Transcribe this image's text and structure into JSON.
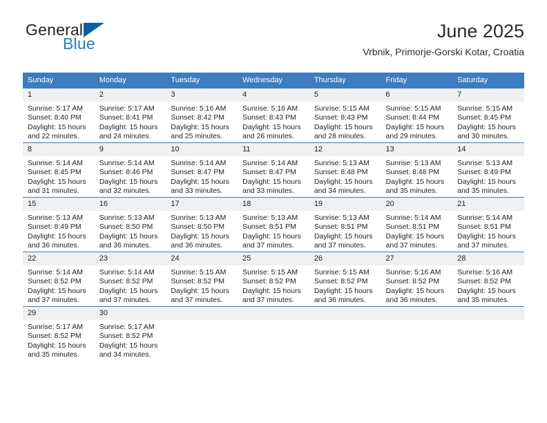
{
  "brand": {
    "word_one": "General",
    "word_two": "Blue",
    "triangle_color": "#0b5ea8",
    "blue_color": "#1f7fc4"
  },
  "header": {
    "title": "June 2025",
    "subtitle": "Vrbnik, Primorje-Gorski Kotar, Croatia"
  },
  "theme": {
    "header_blue": "#3b7dc0",
    "daynum_band": "#f0f0f0",
    "text": "#222222"
  },
  "weekdays": [
    "Sunday",
    "Monday",
    "Tuesday",
    "Wednesday",
    "Thursday",
    "Friday",
    "Saturday"
  ],
  "weeks": [
    [
      {
        "day": "1",
        "sunrise": "Sunrise: 5:17 AM",
        "sunset": "Sunset: 8:40 PM",
        "daylight": "Daylight: 15 hours and 22 minutes."
      },
      {
        "day": "2",
        "sunrise": "Sunrise: 5:17 AM",
        "sunset": "Sunset: 8:41 PM",
        "daylight": "Daylight: 15 hours and 24 minutes."
      },
      {
        "day": "3",
        "sunrise": "Sunrise: 5:16 AM",
        "sunset": "Sunset: 8:42 PM",
        "daylight": "Daylight: 15 hours and 25 minutes."
      },
      {
        "day": "4",
        "sunrise": "Sunrise: 5:16 AM",
        "sunset": "Sunset: 8:43 PM",
        "daylight": "Daylight: 15 hours and 26 minutes."
      },
      {
        "day": "5",
        "sunrise": "Sunrise: 5:15 AM",
        "sunset": "Sunset: 8:43 PM",
        "daylight": "Daylight: 15 hours and 28 minutes."
      },
      {
        "day": "6",
        "sunrise": "Sunrise: 5:15 AM",
        "sunset": "Sunset: 8:44 PM",
        "daylight": "Daylight: 15 hours and 29 minutes."
      },
      {
        "day": "7",
        "sunrise": "Sunrise: 5:15 AM",
        "sunset": "Sunset: 8:45 PM",
        "daylight": "Daylight: 15 hours and 30 minutes."
      }
    ],
    [
      {
        "day": "8",
        "sunrise": "Sunrise: 5:14 AM",
        "sunset": "Sunset: 8:45 PM",
        "daylight": "Daylight: 15 hours and 31 minutes."
      },
      {
        "day": "9",
        "sunrise": "Sunrise: 5:14 AM",
        "sunset": "Sunset: 8:46 PM",
        "daylight": "Daylight: 15 hours and 32 minutes."
      },
      {
        "day": "10",
        "sunrise": "Sunrise: 5:14 AM",
        "sunset": "Sunset: 8:47 PM",
        "daylight": "Daylight: 15 hours and 33 minutes."
      },
      {
        "day": "11",
        "sunrise": "Sunrise: 5:14 AM",
        "sunset": "Sunset: 8:47 PM",
        "daylight": "Daylight: 15 hours and 33 minutes."
      },
      {
        "day": "12",
        "sunrise": "Sunrise: 5:13 AM",
        "sunset": "Sunset: 8:48 PM",
        "daylight": "Daylight: 15 hours and 34 minutes."
      },
      {
        "day": "13",
        "sunrise": "Sunrise: 5:13 AM",
        "sunset": "Sunset: 8:48 PM",
        "daylight": "Daylight: 15 hours and 35 minutes."
      },
      {
        "day": "14",
        "sunrise": "Sunrise: 5:13 AM",
        "sunset": "Sunset: 8:49 PM",
        "daylight": "Daylight: 15 hours and 35 minutes."
      }
    ],
    [
      {
        "day": "15",
        "sunrise": "Sunrise: 5:13 AM",
        "sunset": "Sunset: 8:49 PM",
        "daylight": "Daylight: 15 hours and 36 minutes."
      },
      {
        "day": "16",
        "sunrise": "Sunrise: 5:13 AM",
        "sunset": "Sunset: 8:50 PM",
        "daylight": "Daylight: 15 hours and 36 minutes."
      },
      {
        "day": "17",
        "sunrise": "Sunrise: 5:13 AM",
        "sunset": "Sunset: 8:50 PM",
        "daylight": "Daylight: 15 hours and 36 minutes."
      },
      {
        "day": "18",
        "sunrise": "Sunrise: 5:13 AM",
        "sunset": "Sunset: 8:51 PM",
        "daylight": "Daylight: 15 hours and 37 minutes."
      },
      {
        "day": "19",
        "sunrise": "Sunrise: 5:13 AM",
        "sunset": "Sunset: 8:51 PM",
        "daylight": "Daylight: 15 hours and 37 minutes."
      },
      {
        "day": "20",
        "sunrise": "Sunrise: 5:14 AM",
        "sunset": "Sunset: 8:51 PM",
        "daylight": "Daylight: 15 hours and 37 minutes."
      },
      {
        "day": "21",
        "sunrise": "Sunrise: 5:14 AM",
        "sunset": "Sunset: 8:51 PM",
        "daylight": "Daylight: 15 hours and 37 minutes."
      }
    ],
    [
      {
        "day": "22",
        "sunrise": "Sunrise: 5:14 AM",
        "sunset": "Sunset: 8:52 PM",
        "daylight": "Daylight: 15 hours and 37 minutes."
      },
      {
        "day": "23",
        "sunrise": "Sunrise: 5:14 AM",
        "sunset": "Sunset: 8:52 PM",
        "daylight": "Daylight: 15 hours and 37 minutes."
      },
      {
        "day": "24",
        "sunrise": "Sunrise: 5:15 AM",
        "sunset": "Sunset: 8:52 PM",
        "daylight": "Daylight: 15 hours and 37 minutes."
      },
      {
        "day": "25",
        "sunrise": "Sunrise: 5:15 AM",
        "sunset": "Sunset: 8:52 PM",
        "daylight": "Daylight: 15 hours and 37 minutes."
      },
      {
        "day": "26",
        "sunrise": "Sunrise: 5:15 AM",
        "sunset": "Sunset: 8:52 PM",
        "daylight": "Daylight: 15 hours and 36 minutes."
      },
      {
        "day": "27",
        "sunrise": "Sunrise: 5:16 AM",
        "sunset": "Sunset: 8:52 PM",
        "daylight": "Daylight: 15 hours and 36 minutes."
      },
      {
        "day": "28",
        "sunrise": "Sunrise: 5:16 AM",
        "sunset": "Sunset: 8:52 PM",
        "daylight": "Daylight: 15 hours and 35 minutes."
      }
    ],
    [
      {
        "day": "29",
        "sunrise": "Sunrise: 5:17 AM",
        "sunset": "Sunset: 8:52 PM",
        "daylight": "Daylight: 15 hours and 35 minutes."
      },
      {
        "day": "30",
        "sunrise": "Sunrise: 5:17 AM",
        "sunset": "Sunset: 8:52 PM",
        "daylight": "Daylight: 15 hours and 34 minutes."
      },
      {
        "day": "",
        "sunrise": "",
        "sunset": "",
        "daylight": ""
      },
      {
        "day": "",
        "sunrise": "",
        "sunset": "",
        "daylight": ""
      },
      {
        "day": "",
        "sunrise": "",
        "sunset": "",
        "daylight": ""
      },
      {
        "day": "",
        "sunrise": "",
        "sunset": "",
        "daylight": ""
      },
      {
        "day": "",
        "sunrise": "",
        "sunset": "",
        "daylight": ""
      }
    ]
  ]
}
